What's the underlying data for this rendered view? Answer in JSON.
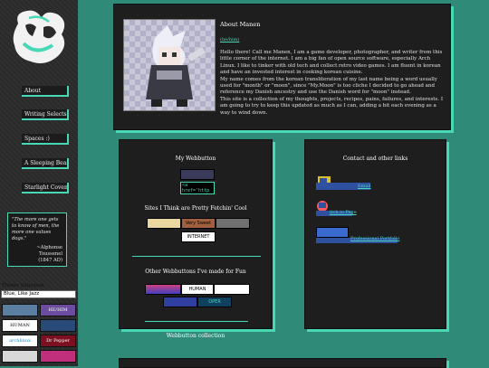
{
  "nav": [
    "About",
    "Writing Selects",
    "Spaces :)",
    "A Sleeping Bear",
    "Starlight Covenant"
  ],
  "quote": {
    "text": "\"The more one gets to know of men, the more one values dogs.\"",
    "author": "~Alphonse Toussenel",
    "years": "(1847 AD)"
  },
  "theme": {
    "label": "Theme Selection",
    "value": "Blue, Like Jazz"
  },
  "side_buttons": [
    "",
    "HE/HIM",
    "HUMAN MADE",
    "",
    "archlinux",
    "Dr Pepper",
    "",
    "",
    "",
    ""
  ],
  "about": {
    "title": "About Manen",
    "link": "(he/him)",
    "text": "Hello there! Call me Manen, I am a game developer, photographer, and writer from this little corner of the internet. I am a big fan of open source software, especially Arch Linux. I like to tinker with old tech and collect retro video games. I am fluent in korean and have an invested interest in cooking korean cuisine.\nMy name comes from the korean transliteration of my last name being a word usually used for \"month\" or \"moon\", since \"My.Moon\" is too cliche I decided to go ahead and reference my Danish ancestry and use the Danish word for \"moon\" instead.\nThis site is a collection of my thoughts, projects, recipes, pains, failures, and interests. I am going to try to keep this updated as much as I can, adding a bit each evening as a way to wind down."
  },
  "left_panel": {
    "t1": "My Webbutton",
    "code": "<a href='http",
    "t2": "Sites I Think are Pretty Fetchin' Cool",
    "cool_buttons": [
      "",
      "Very Sweet",
      "",
      "",
      "",
      "INTERNET ARCHIVE"
    ],
    "t3": "Other Webbuttons I've made for Fun",
    "fun_buttons": [
      "",
      "HUMAN MADE",
      "",
      "",
      "",
      "OPER"
    ],
    "t4": "Webbutton collection"
  },
  "right_panel": {
    "title": "Contact and other links",
    "links": [
      "Email",
      "itch.io Page",
      "Professional Portfolio"
    ]
  }
}
